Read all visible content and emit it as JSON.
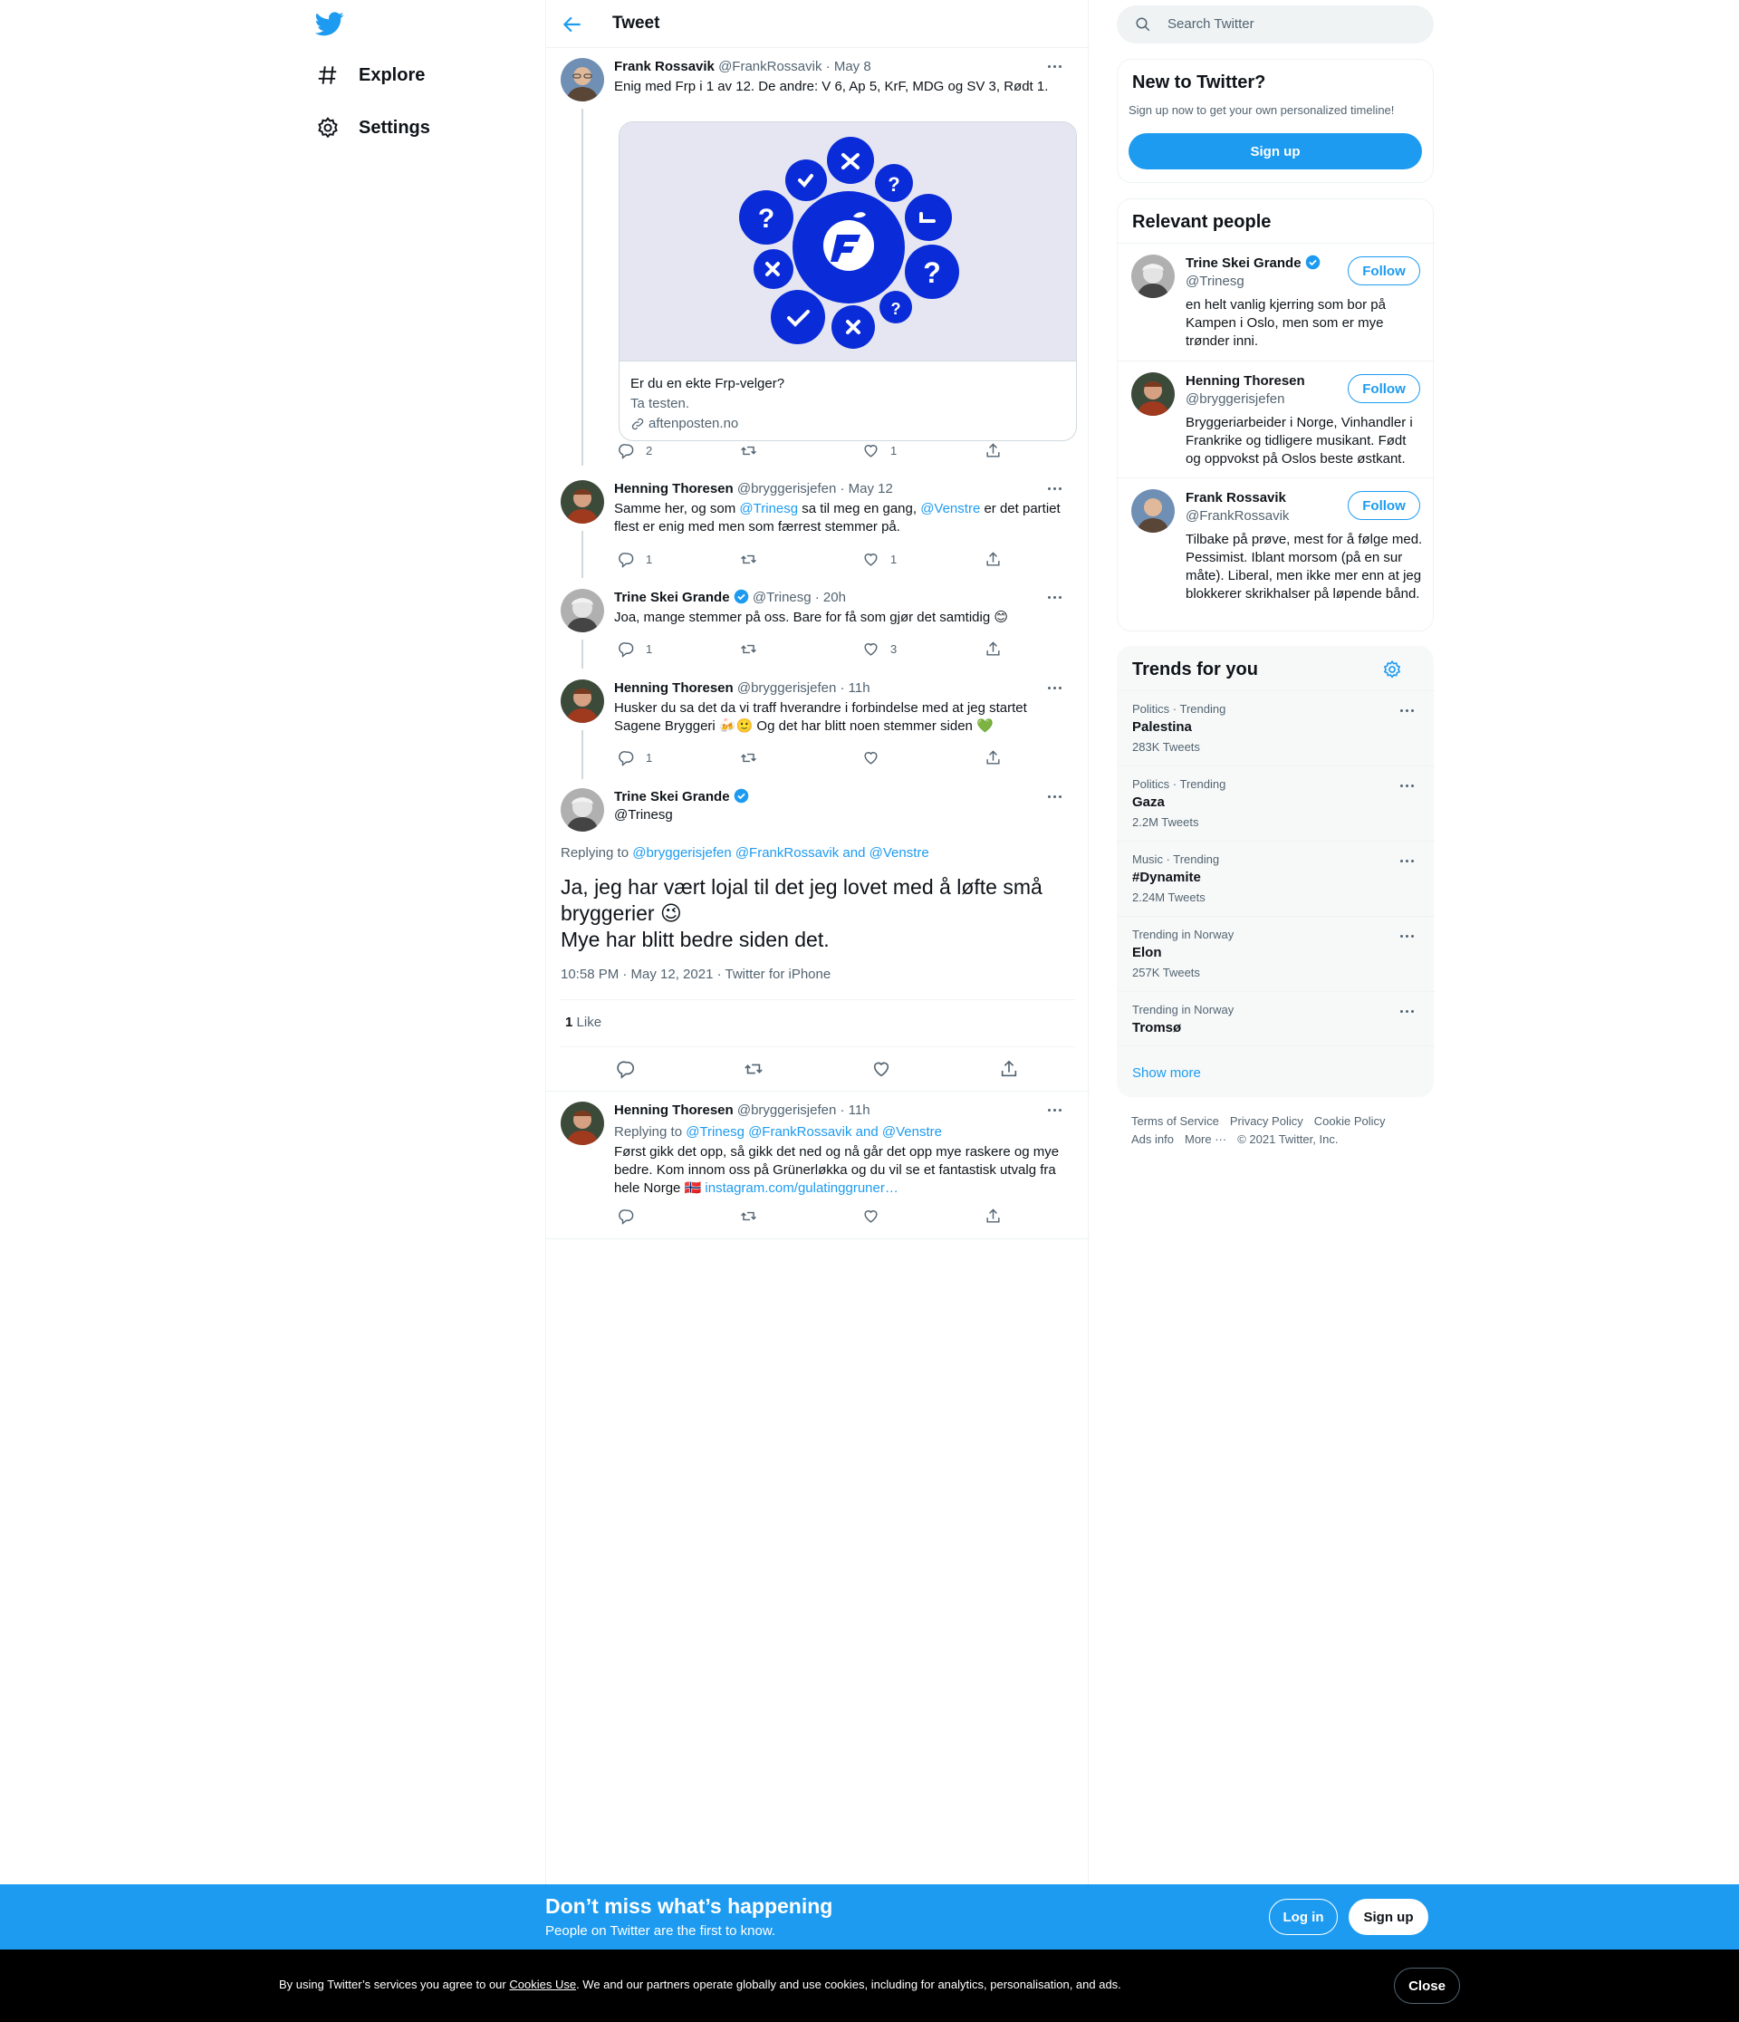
{
  "nav": {
    "explore": "Explore",
    "settings": "Settings"
  },
  "header": {
    "title": "Tweet"
  },
  "tweets": [
    {
      "name": "Frank Rossavik",
      "handle": "@FrankRossavik",
      "date": "· May 8",
      "text": "Enig med Frp i 1 av 12. De andre: V 6, Ap 5, KrF, MDG og SV 3, Rødt 1.",
      "card": {
        "title": "Er du en ekte Frp-velger?",
        "desc": "Ta testen.",
        "domain": "aftenposten.no"
      },
      "replies": "2",
      "retweets": "",
      "likes": "1"
    },
    {
      "name": "Henning Thoresen",
      "handle": "@bryggerisjefen",
      "date": "· May 12",
      "text_a": "Samme her, og som ",
      "mention1": "@Trinesg",
      "text_b": " sa til meg en gang, ",
      "mention2": "@Venstre",
      "text_c": " er det partiet flest er enig med men som færrest stemmer på.",
      "replies": "1",
      "retweets": "",
      "likes": "1"
    },
    {
      "name": "Trine Skei Grande",
      "handle": "@Trinesg",
      "date": "· 20h",
      "text": "Joa, mange stemmer på oss. Bare for få som gjør det samtidig 😊",
      "replies": "1",
      "retweets": "",
      "likes": "3"
    },
    {
      "name": "Henning Thoresen",
      "handle": "@bryggerisjefen",
      "date": "· 11h",
      "text": "Husker du sa det da vi traff hverandre i forbindelse med at jeg startet Sagene Bryggeri 🍻🙂 Og det har blitt noen stemmer siden 💚",
      "replies": "1",
      "retweets": "",
      "likes": ""
    }
  ],
  "main_tweet": {
    "name": "Trine Skei Grande",
    "handle": "@Trinesg",
    "replying_label": "Replying to",
    "replying_to": "@bryggerisjefen @FrankRossavik and @Venstre",
    "text_line1": "Ja, jeg har vært lojal til det jeg lovet med å løfte små bryggerier 😉",
    "text_line2": "Mye har blitt bedre siden det.",
    "meta": "10:58 PM · May 12, 2021 · Twitter for iPhone",
    "like_count": "1",
    "like_label": "Like"
  },
  "reply": {
    "name": "Henning Thoresen",
    "handle": "@bryggerisjefen",
    "date": "· 11h",
    "replying_label": "Replying to",
    "replying_to": "@Trinesg @FrankRossavik and @Venstre",
    "text": "Først gikk det opp, så gikk det ned og nå går det opp mye raskere og mye bedre. Kom innom oss på Grünerløkka og du vil se et fantastisk utvalg fra hele Norge 🇳🇴 ",
    "link": "instagram.com/gulatinggruner…"
  },
  "search": {
    "placeholder": "Search Twitter"
  },
  "new_to_twitter": {
    "title": "New to Twitter?",
    "subtitle": "Sign up now to get your own personalized timeline!",
    "button": "Sign up"
  },
  "relevant_people": {
    "title": "Relevant people",
    "follow_label": "Follow",
    "people": [
      {
        "name": "Trine Skei Grande",
        "handle": "@Trinesg",
        "bio": "en helt vanlig kjerring som bor på Kampen i Oslo, men som er mye trønder inni."
      },
      {
        "name": "Henning Thoresen",
        "handle": "@bryggerisjefen",
        "bio": "Bryggeriarbeider i Norge, Vinhandler i Frankrike og tidligere musikant. Født og oppvokst på Oslos beste østkant."
      },
      {
        "name": "Frank Rossavik",
        "handle": "@FrankRossavik",
        "bio": "Tilbake på prøve, mest for å følge med. Pessimist. Iblant morsom (på en sur måte). Liberal, men ikke mer enn at jeg blokkerer skrikhalser på løpende bånd."
      }
    ]
  },
  "trends": {
    "title": "Trends for you",
    "items": [
      {
        "context": "Politics · Trending",
        "name": "Palestina",
        "count": "283K Tweets"
      },
      {
        "context": "Politics · Trending",
        "name": "Gaza",
        "count": "2.2M Tweets"
      },
      {
        "context": "Music · Trending",
        "name": "#Dynamite",
        "count": "2.24M Tweets"
      },
      {
        "context": "Trending in Norway",
        "name": "Elon",
        "count": "257K Tweets"
      },
      {
        "context": "Trending in Norway",
        "name": "Tromsø",
        "count": ""
      }
    ],
    "show_more": "Show more"
  },
  "footer": {
    "terms": "Terms of Service",
    "privacy": "Privacy Policy",
    "cookie": "Cookie Policy",
    "ads": "Ads info",
    "more": "More ···",
    "copyright": "© 2021 Twitter, Inc."
  },
  "signup_bar": {
    "title": "Don’t miss what’s happening",
    "subtitle": "People on Twitter are the first to know.",
    "login": "Log in",
    "signup": "Sign up"
  },
  "cookie_bar": {
    "text_a": "By using Twitter’s services you agree to our ",
    "link": "Cookies Use",
    "text_b": ". We and our partners operate globally and use cookies, including for analytics, personalisation, and ads.",
    "close": "Close"
  },
  "colors": {
    "accent": "#1d9bf0",
    "text": "#0f1419",
    "muted": "#536471",
    "verified": "#1d9bf0",
    "frp_blue": "#0a2bd8"
  }
}
